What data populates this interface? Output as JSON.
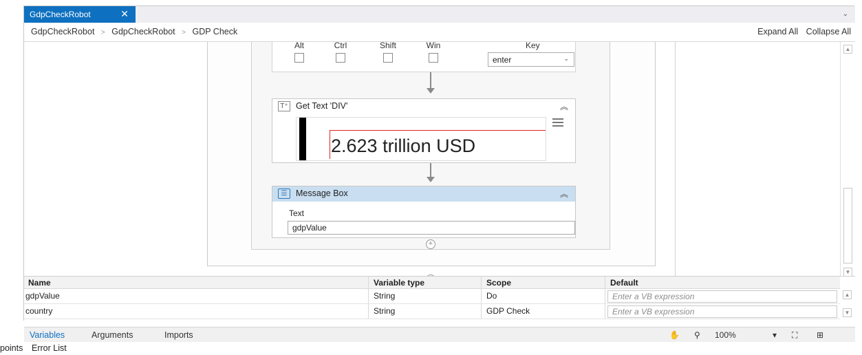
{
  "tab": {
    "title": "GdpCheckRobot",
    "close_icon": "close-icon",
    "overflow_icon": "chevron-down-icon"
  },
  "breadcrumb": {
    "items": [
      "GdpCheckRobot",
      "GdpCheckRobot",
      "GDP Check"
    ],
    "separator": ">"
  },
  "expand": {
    "expand_all": "Expand All",
    "collapse_all": "Collapse All"
  },
  "hotkey": {
    "modifiers": [
      "Alt",
      "Ctrl",
      "Shift",
      "Win"
    ],
    "key_label": "Key",
    "key_value": "enter"
  },
  "get_text": {
    "title": "Get Text 'DIV'",
    "preview_text": "2.623 trillion USD"
  },
  "message_box": {
    "title": "Message Box",
    "field_label": "Text",
    "field_value": "gdpValue"
  },
  "variables": {
    "columns": [
      "Name",
      "Variable type",
      "Scope",
      "Default"
    ],
    "rows": [
      {
        "name": "gdpValue",
        "type": "String",
        "scope": "Do",
        "default_placeholder": "Enter a VB expression"
      },
      {
        "name": "country",
        "type": "String",
        "scope": "GDP Check",
        "default_placeholder": "Enter a VB expression"
      }
    ]
  },
  "bottom_tabs": [
    "Variables",
    "Arguments",
    "Imports"
  ],
  "zoom": "100%",
  "footer_tabs": [
    "points",
    "Error List"
  ],
  "colors": {
    "accent": "#0e70c0",
    "activity_header": "#c9def0",
    "breakpoint_red": "#dd2222"
  }
}
